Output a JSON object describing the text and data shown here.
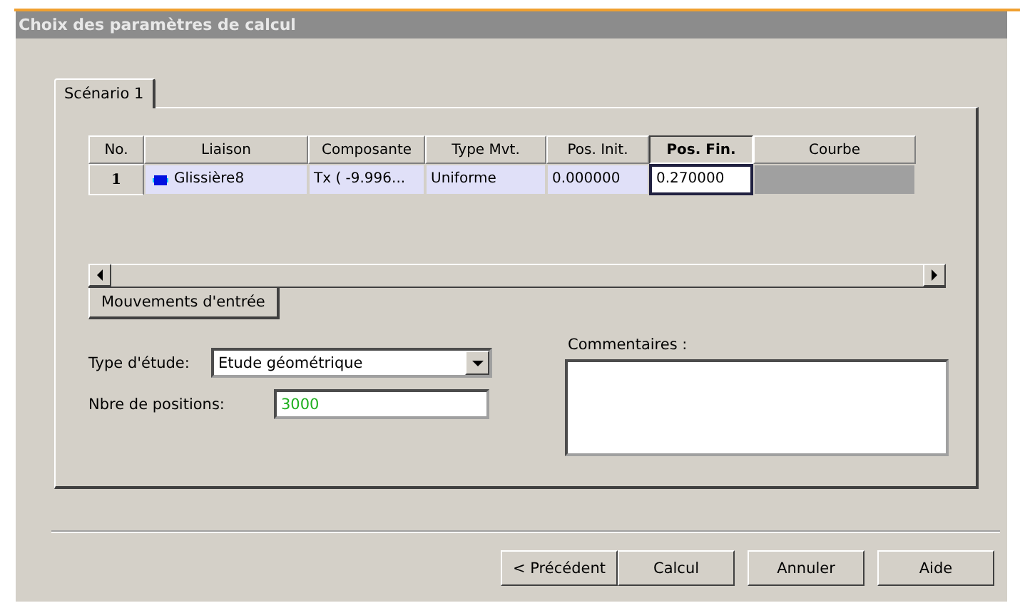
{
  "window": {
    "title": "Choix des paramètres de calcul"
  },
  "tabs": [
    {
      "label": "Scénario 1",
      "selected": true
    }
  ],
  "table": {
    "columns": [
      {
        "label": "No.",
        "selected": false
      },
      {
        "label": "Liaison",
        "selected": false
      },
      {
        "label": "Composante",
        "selected": false
      },
      {
        "label": "Type Mvt.",
        "selected": false
      },
      {
        "label": "Pos. Init.",
        "selected": false
      },
      {
        "label": "Pos. Fin.",
        "selected": true
      },
      {
        "label": "Courbe",
        "selected": false
      }
    ],
    "rows": [
      {
        "cells": [
          {
            "kind": "number",
            "text": "1",
            "focused": false
          },
          {
            "kind": "joint",
            "text": "Glissière8",
            "focused": false
          },
          {
            "kind": "text",
            "text": "Tx ( -9.996...",
            "focused": false
          },
          {
            "kind": "text",
            "text": "Uniforme",
            "focused": false
          },
          {
            "kind": "text",
            "text": "0.000000",
            "focused": false
          },
          {
            "kind": "text",
            "text": "0.270000",
            "focused": true
          },
          {
            "kind": "empty",
            "focused": false
          }
        ]
      }
    ]
  },
  "sub_tabs": [
    {
      "label": "Mouvements d'entrée",
      "selected": true
    }
  ],
  "study_type": {
    "label": "Type d'étude:",
    "value": "Etude géométrique"
  },
  "positions": {
    "label": "Nbre de positions:",
    "value": "3000"
  },
  "comments": {
    "label": "Commentaires :"
  },
  "buttons": [
    "< Précédent",
    "Calcul",
    "Annuler",
    "Aide"
  ]
}
